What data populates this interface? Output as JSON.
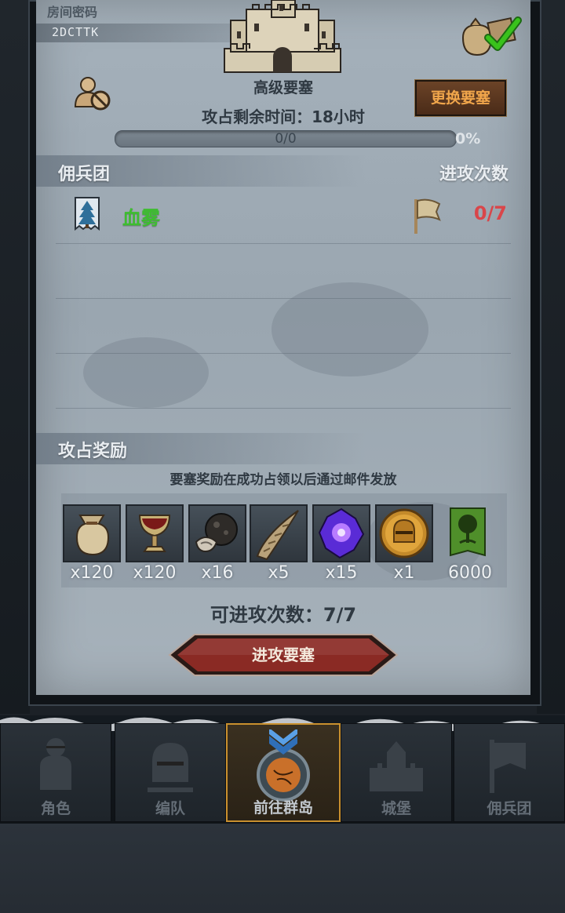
{
  "room": {
    "label": "房间密码",
    "code": "2DCTTK"
  },
  "fortress": {
    "name": "高级要塞",
    "change_button": "更换要塞",
    "timer_text": "攻占剩余时间：18小时",
    "progress_text": "0/0",
    "progress_percent": "0%",
    "progress_fraction": 0
  },
  "mercenary_section": {
    "title": "佣兵团",
    "attacks_title": "进攻次数"
  },
  "mercenaries": [
    {
      "name": "血雾",
      "attacks": "0/7",
      "name_color": "#3dbd2f",
      "attacks_color": "#d9464a"
    }
  ],
  "rewards_section": {
    "title": "攻占奖励",
    "note": "要塞奖励在成功占领以后通过邮件发放"
  },
  "rewards": [
    {
      "icon": "sack-icon",
      "qty": "x120"
    },
    {
      "icon": "goblet-icon",
      "qty": "x120"
    },
    {
      "icon": "truffle-icon",
      "qty": "x16"
    },
    {
      "icon": "horn-icon",
      "qty": "x5"
    },
    {
      "icon": "magic-gem-icon",
      "qty": "x15"
    },
    {
      "icon": "knight-helmet-coin-icon",
      "qty": "x1"
    },
    {
      "icon": "tree-banner-icon",
      "qty": "6000"
    }
  ],
  "remaining_attacks": "可进攻次数：7/7",
  "attack_button": "进攻要塞",
  "nav": [
    {
      "label": "角色",
      "icon": "knight-icon"
    },
    {
      "label": "编队",
      "icon": "helmet-icon"
    },
    {
      "label": "前往群岛",
      "icon": "compass-icon",
      "active": true
    },
    {
      "label": "城堡",
      "icon": "castle-icon"
    },
    {
      "label": "佣兵团",
      "icon": "mercenary-banner-icon"
    }
  ],
  "colors": {
    "panel": "#a5b1bb",
    "accent_button": "#f1a64b",
    "active_tab": "#c9902e",
    "attack_button": "#8a2a24"
  }
}
